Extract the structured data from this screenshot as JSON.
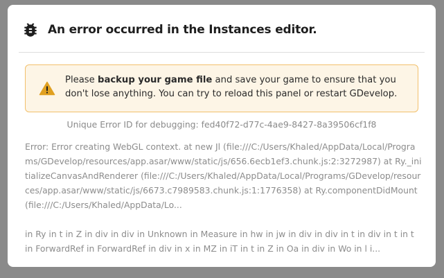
{
  "dialog": {
    "title": "An error occurred in the Instances editor.",
    "title_icon": "bug-icon"
  },
  "alert": {
    "icon": "warning-icon",
    "text_before": "Please ",
    "text_bold": "backup your game file",
    "text_after": " and save your game to ensure that you don't lose anything. You can try to reload this panel or restart GDevelop.",
    "accent_color": "#f2c06b",
    "background_color": "#fdf5e6"
  },
  "error_id": "Unique Error ID for debugging: fed40f72-d77c-4ae9-8427-8a39506cf1f8",
  "error_message": "Error: Error creating WebGL context. at new Jl (file:///C:/Users/Khaled/AppData/Local/Programs/GDevelop/resources/app.asar/www/static/js/656.6ecb1ef3.chunk.js:2:3272987) at Ry._initializeCanvasAndRenderer (file:///C:/Users/Khaled/AppData/Local/Programs/GDevelop/resources/app.asar/www/static/js/6673.c7989583.chunk.js:1:1776358) at Ry.componentDidMount (file:///C:/Users/Khaled/AppData/Lo...",
  "component_stack": "in Ry in t in Z in div in div in Unknown in Measure in hw in jw in div in div in t in div in t in t in ForwardRef in ForwardRef in div in x in MZ in iT in t in Z in Oa in div in Wo in l i..."
}
